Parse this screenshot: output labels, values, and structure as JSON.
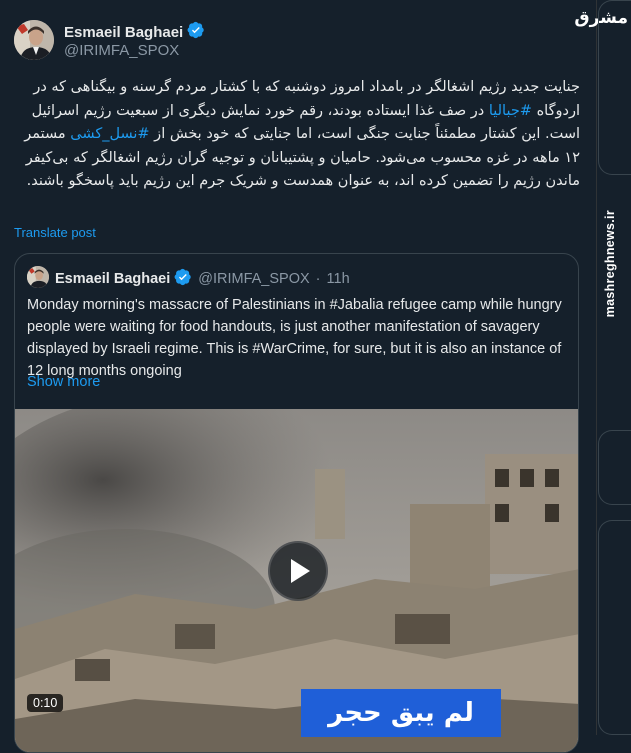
{
  "tweet": {
    "author_name": "Esmaeil Baghaei",
    "handle": "@IRIMFA_SPOX",
    "body": {
      "p1": "جنایت جدید رژیم اشغالگر در بامداد امروز دوشنبه که با کشتار مردم گرسنه و بیگناهی که در اردوگاه ",
      "tag1": "#جبالیا",
      "p2": " در صف غذا ایستاده بودند، رقم خورد نمایش دیگری از سبعیت رژیم اسرائیل است. این کشتار مطمئناً جنایت جنگی است، اما جنایتی که خود بخش از ",
      "tag2": "#نسل_کشی",
      "p3": " مستمر ۱۲ ماهه در غزه محسوب می‌شود. حامیان و پشتیبانان و توجیه گران رژیم اشغالگر که بی‌کیفر ماندن رژیم را تضمین کرده اند، به عنوان همدست و شریک جرم این رژیم باید پاسخگو باشند."
    },
    "translate_label": "Translate post"
  },
  "quote": {
    "author_name": "Esmaeil Baghaei",
    "handle": "@IRIMFA_SPOX",
    "dot": "·",
    "time": "11h",
    "text": "Monday morning's massacre of Palestinians in #Jabalia refugee camp while hungry people were waiting for food handouts, is just another manifestation of savagery displayed by Israeli regime. This is #WarCrime, for sure, but it is also an instance of 12 long months ongoing",
    "show_more": "Show more",
    "video": {
      "duration": "0:10",
      "caption": "لم يبق حجر"
    }
  },
  "watermark": {
    "logo": "مشرق",
    "site": "mashreghnews.ir"
  },
  "colors": {
    "background": "#15202b",
    "accent": "#1d9bf0",
    "secondary_text": "#8b98a5",
    "border": "#38444d"
  },
  "icons": [
    "verified-badge-icon",
    "play-icon"
  ]
}
